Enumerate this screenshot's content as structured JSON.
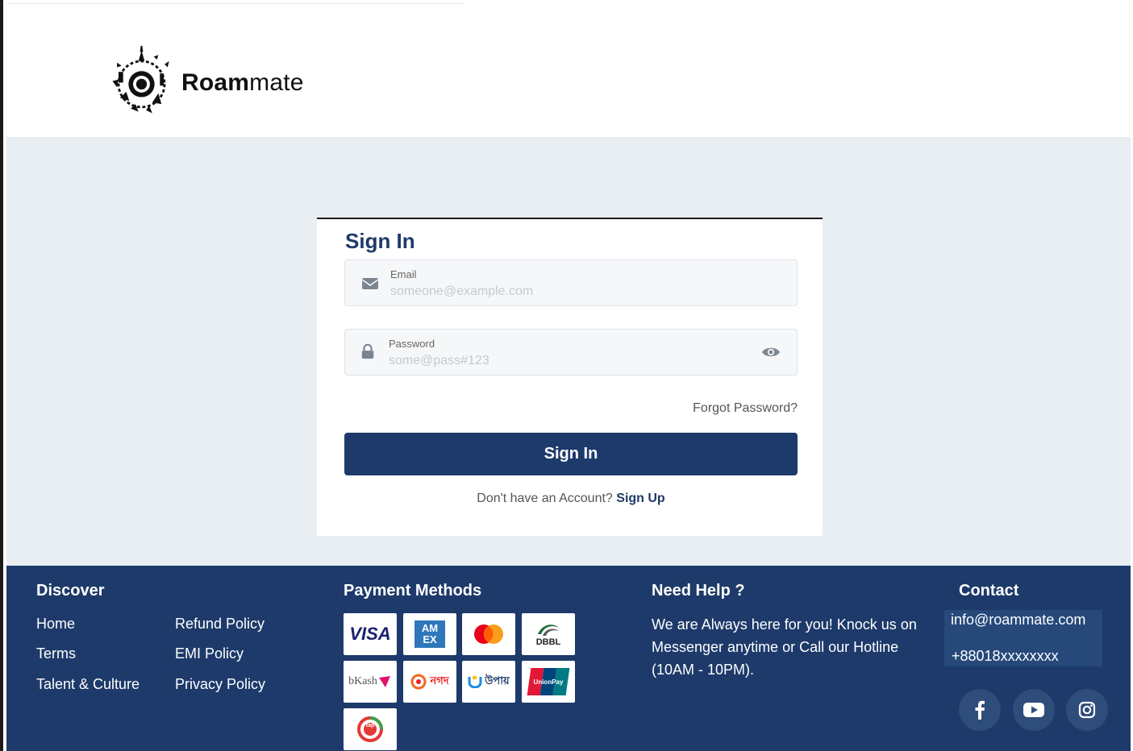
{
  "brand": {
    "logo_text_bold": "Roam",
    "logo_text_light": "mate"
  },
  "signin": {
    "title": "Sign In",
    "email": {
      "label": "Email",
      "placeholder": "someone@example.com",
      "icon": "envelope-icon"
    },
    "password": {
      "label": "Password",
      "placeholder": "some@pass#123",
      "icon": "lock-icon",
      "toggle_icon": "eye-icon"
    },
    "forgot_label": "Forgot Password?",
    "button_label": "Sign In",
    "no_account_text": "Don't have an Account?",
    "signup_label": "Sign Up"
  },
  "footer": {
    "discover": {
      "title": "Discover",
      "links_col1": [
        "Home",
        "Terms",
        "Talent & Culture"
      ],
      "links_col2": [
        "Refund Policy",
        "EMI Policy",
        "Privacy Policy"
      ]
    },
    "payment": {
      "title": "Payment Methods",
      "methods": [
        "VISA",
        "AMEX",
        "Mastercard",
        "DBBL",
        "bKash",
        "Nagad",
        "Upay",
        "UnionPay",
        "tap"
      ],
      "labels": {
        "visa": "VISA",
        "amex": "AM EX",
        "dbbl": "DBBL",
        "bkash": "bKash",
        "nagad": "নগদ",
        "upay": "উপায়",
        "unionpay": "UnionPay",
        "tap": "tap"
      }
    },
    "help": {
      "title": "Need Help ?",
      "text": "We are Always here for you! Knock us on Messenger anytime or Call our Hotline (10AM - 10PM)."
    },
    "contact": {
      "title": "Contact",
      "email": "info@roammate.com",
      "phone": "+88018xxxxxxxx",
      "social_icons": [
        "facebook-icon",
        "youtube-icon",
        "instagram-icon"
      ]
    }
  },
  "colors": {
    "primary": "#1d3a6a",
    "page_bg": "#e9eef3",
    "footer_box": "#26497a",
    "social_bg": "#2e4d7a"
  }
}
